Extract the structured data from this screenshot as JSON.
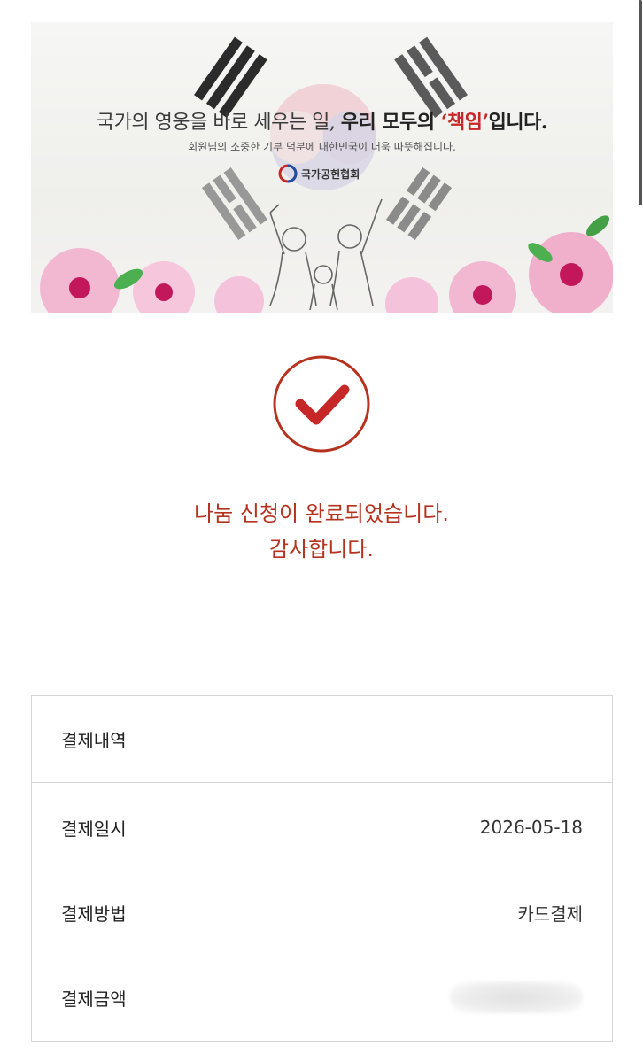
{
  "banner": {
    "headline_pre": "국가의 영웅을 바로 세우는 일, ",
    "headline_bold": "우리 모두의 ",
    "headline_accent": "‘책임’",
    "headline_post": "입니다.",
    "subtext": "회원님의 소중한 기부 덕분에 대한민국이 더욱 따뜻해집니다.",
    "logo_text": "국가공헌협회"
  },
  "status": {
    "line1": "나눔 신청이 완료되었습니다.",
    "line2": "감사합니다."
  },
  "payment": {
    "header": "결제내역",
    "rows": [
      {
        "label": "결제일시",
        "value": "2026-05-18"
      },
      {
        "label": "결제방법",
        "value": "카드결제"
      },
      {
        "label": "결제금액",
        "value": ""
      }
    ]
  },
  "colors": {
    "accent": "#b5321f",
    "border": "#d6d6d6"
  }
}
